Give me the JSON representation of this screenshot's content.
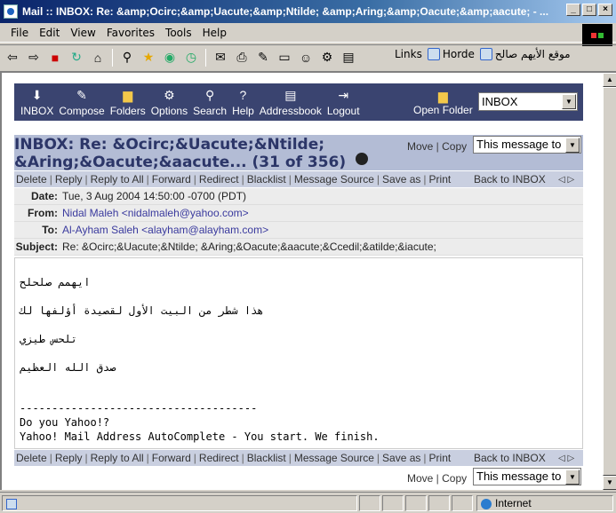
{
  "window": {
    "title": "Mail :: INBOX: Re: &amp;Ocirc;&amp;Uacute;&amp;Ntilde; &amp;Aring;&amp;Oacute;&amp;aacute; - ...",
    "controls": [
      "_",
      "□",
      "×"
    ]
  },
  "menubar": [
    "File",
    "Edit",
    "View",
    "Favorites",
    "Tools",
    "Help"
  ],
  "links": {
    "label": "Links",
    "items": [
      "Horde",
      "موقع الأيهم صالح"
    ]
  },
  "nav": {
    "buttons": [
      "INBOX",
      "Compose",
      "Folders",
      "Options",
      "Search",
      "Help",
      "Addressbook",
      "Logout"
    ],
    "open_folder": "Open Folder",
    "folder_select": "INBOX"
  },
  "message": {
    "title_line1": "INBOX: Re: &Ocirc;&Uacute;&Ntilde;",
    "title_line2": "&Aring;&Oacute;&aacute... (31 of 356)",
    "move": "Move",
    "copy": "Copy",
    "target_select": "This message to",
    "actions": [
      "Delete",
      "Reply",
      "Reply to All",
      "Forward",
      "Redirect",
      "Blacklist",
      "Message Source",
      "Save as",
      "Print"
    ],
    "back": "Back to INBOX",
    "headers": {
      "date_label": "Date:",
      "date": "Tue, 3 Aug 2004 14:50:00 -0700 (PDT)",
      "from_label": "From:",
      "from": "Nidal Maleh <nidalmaleh@yahoo.com>",
      "to_label": "To:",
      "to": "Al-Ayham Saleh <alayham@alayham.com>",
      "subject_label": "Subject:",
      "subject": "Re: &Ocirc;&Uacute;&Ntilde; &Aring;&Oacute;&aacute;&Ccedil;&atilde;&iacute;"
    },
    "body": {
      "line1": "ايهمم صلحلح",
      "line2": "هذا شطر من البيت الأول لقصيدة أؤلفها لك",
      "line3": "تلحس طيزي",
      "line4": "صدق الله العظيم",
      "rule": "-------------------------------------",
      "footer1": "Do you Yahoo!?",
      "footer2": "Yahoo! Mail Address AutoComplete - You start. We finish."
    }
  },
  "status": {
    "zone": "Internet"
  }
}
